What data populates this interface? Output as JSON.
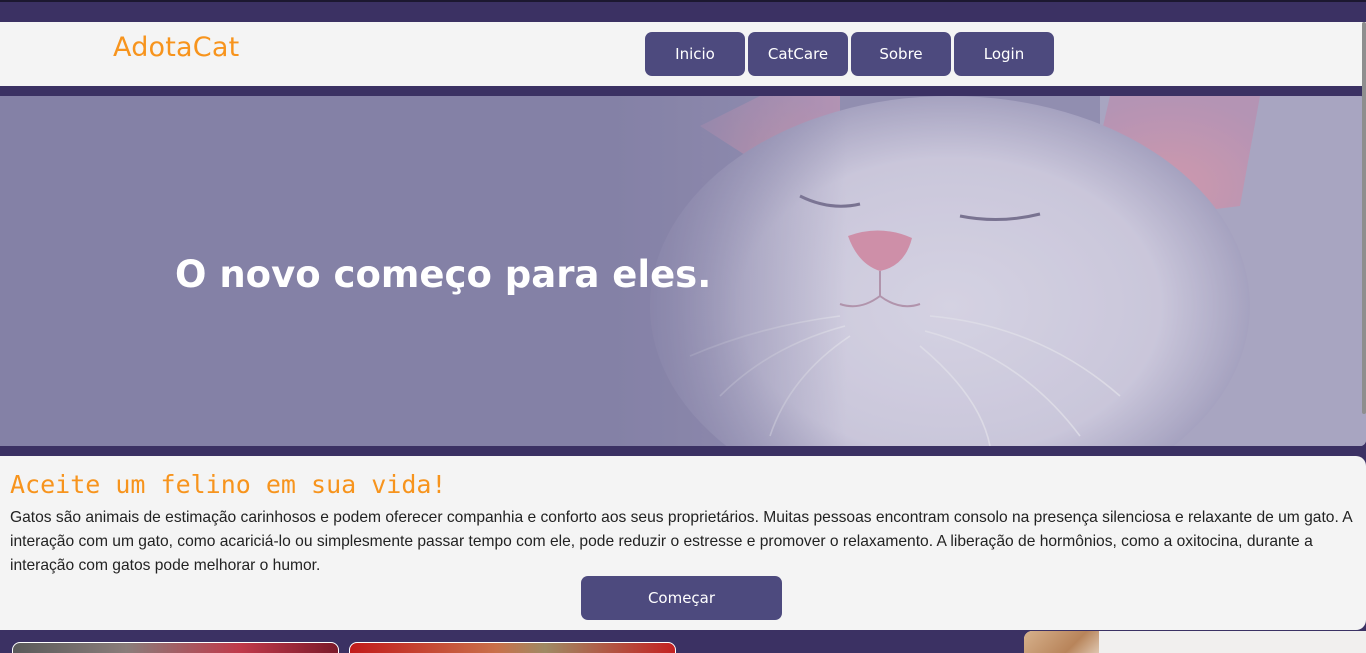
{
  "header": {
    "logo": "AdotaCat",
    "nav": [
      {
        "label": "Inicio"
      },
      {
        "label": "CatCare"
      },
      {
        "label": "Sobre"
      },
      {
        "label": "Login"
      }
    ]
  },
  "hero": {
    "title": "O novo começo para eles."
  },
  "intro": {
    "title": "Aceite um felino em sua vida!",
    "text": "Gatos são animais de estimação carinhosos e podem oferecer companhia e conforto aos seus proprietários. Muitas pessoas encontram consolo na presença silenciosa e relaxante de um gato. A interação com um gato, como acariciá-lo ou simplesmente passar tempo com ele, pode reduzir o estresse e promover o relaxamento. A liberação de hormônios, como a oxitocina, durante a interação com gatos pode melhorar o humor.",
    "button": "Começar"
  },
  "colors": {
    "accent": "#f7941d",
    "primary": "#4d4a7e",
    "background": "#3b3163",
    "surface": "#f4f4f4"
  }
}
